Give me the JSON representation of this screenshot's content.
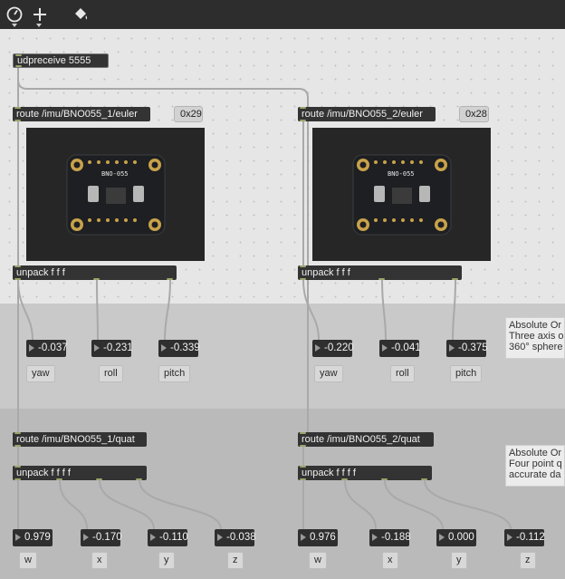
{
  "toolbar": {
    "icons": [
      "speedometer-icon",
      "plus-icon",
      "paint-bucket-icon"
    ]
  },
  "patch": {
    "udp": "udpreceive 5555",
    "sensors": [
      {
        "route_euler": "route /imu/BNO055_1/euler",
        "address": "0x29",
        "board_text": "BNO-055",
        "unpack_euler": "unpack f f f",
        "euler_values": [
          "-0.037",
          "-0.231",
          "-0.339"
        ],
        "euler_labels": [
          "yaw",
          "roll",
          "pitch"
        ],
        "route_quat": "route /imu/BNO055_1/quat",
        "unpack_quat": "unpack f f f f",
        "quat_values": [
          "0.979",
          "-0.170",
          "-0.110",
          "-0.038"
        ],
        "quat_labels": [
          "w",
          "x",
          "y",
          "z"
        ]
      },
      {
        "route_euler": "route /imu/BNO055_2/euler",
        "address": "0x28",
        "board_text": "BNO-055",
        "unpack_euler": "unpack f f f",
        "euler_values": [
          "-0.220",
          "-0.041",
          "-0.375"
        ],
        "euler_labels": [
          "yaw",
          "roll",
          "pitch"
        ],
        "route_quat": "route /imu/BNO055_2/quat",
        "unpack_quat": "unpack f f f f",
        "quat_values": [
          "0.976",
          "-0.188",
          "0.000",
          "-0.112"
        ],
        "quat_labels": [
          "w",
          "x",
          "y",
          "z"
        ]
      }
    ],
    "comment_euler": [
      "Absolute Or",
      "Three axis o",
      "360° sphere"
    ],
    "comment_quat": [
      "Absolute Or",
      "Four point q",
      "accurate da"
    ]
  },
  "colors": {
    "object_bg": "#333333",
    "inlet": "#9aa56a",
    "cable": "#a9a9a9",
    "panel_euler": "#c9c9c9",
    "panel_quat": "#bababa"
  }
}
